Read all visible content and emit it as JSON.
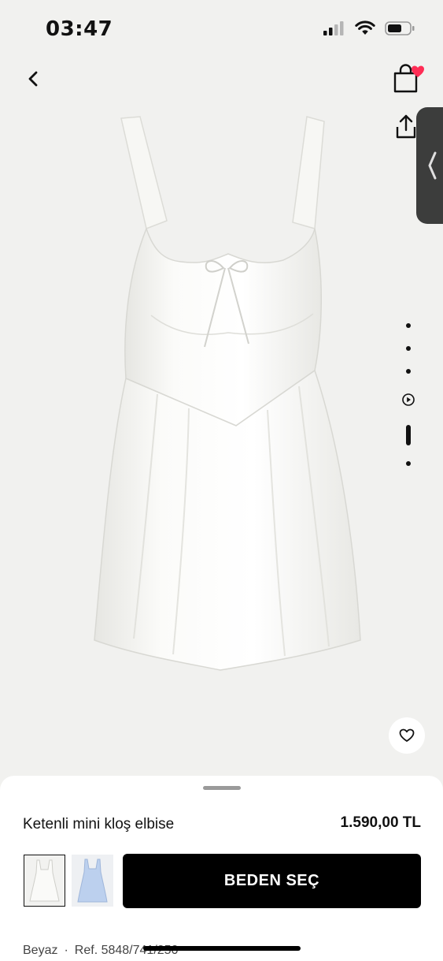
{
  "status_bar": {
    "time": "03:47",
    "icons": [
      "cellular-signal-icon",
      "wifi-icon",
      "battery-icon"
    ]
  },
  "header": {
    "back_icon": "chevron-left-icon",
    "cart_icon": "shopping-bag-icon",
    "cart_badge_icon": "heart-badge-icon",
    "share_icon": "share-icon",
    "side_tab_icon": "chevron-left-icon"
  },
  "gallery": {
    "total_items": 6,
    "active_index": 4,
    "video_index": 3
  },
  "product": {
    "name": "Ketenli mini kloş elbise",
    "price": "1.590,00 TL",
    "color": "Beyaz",
    "separator": "·",
    "ref": "Ref. 5848/741/250"
  },
  "actions": {
    "size_button": "BEDEN SEÇ",
    "favorite_icon": "heart-outline-icon"
  },
  "colors": {
    "background": "#f1f1ef",
    "button": "#000000",
    "badge": "#ff2d55",
    "side_tab": "#3c3d3c"
  }
}
